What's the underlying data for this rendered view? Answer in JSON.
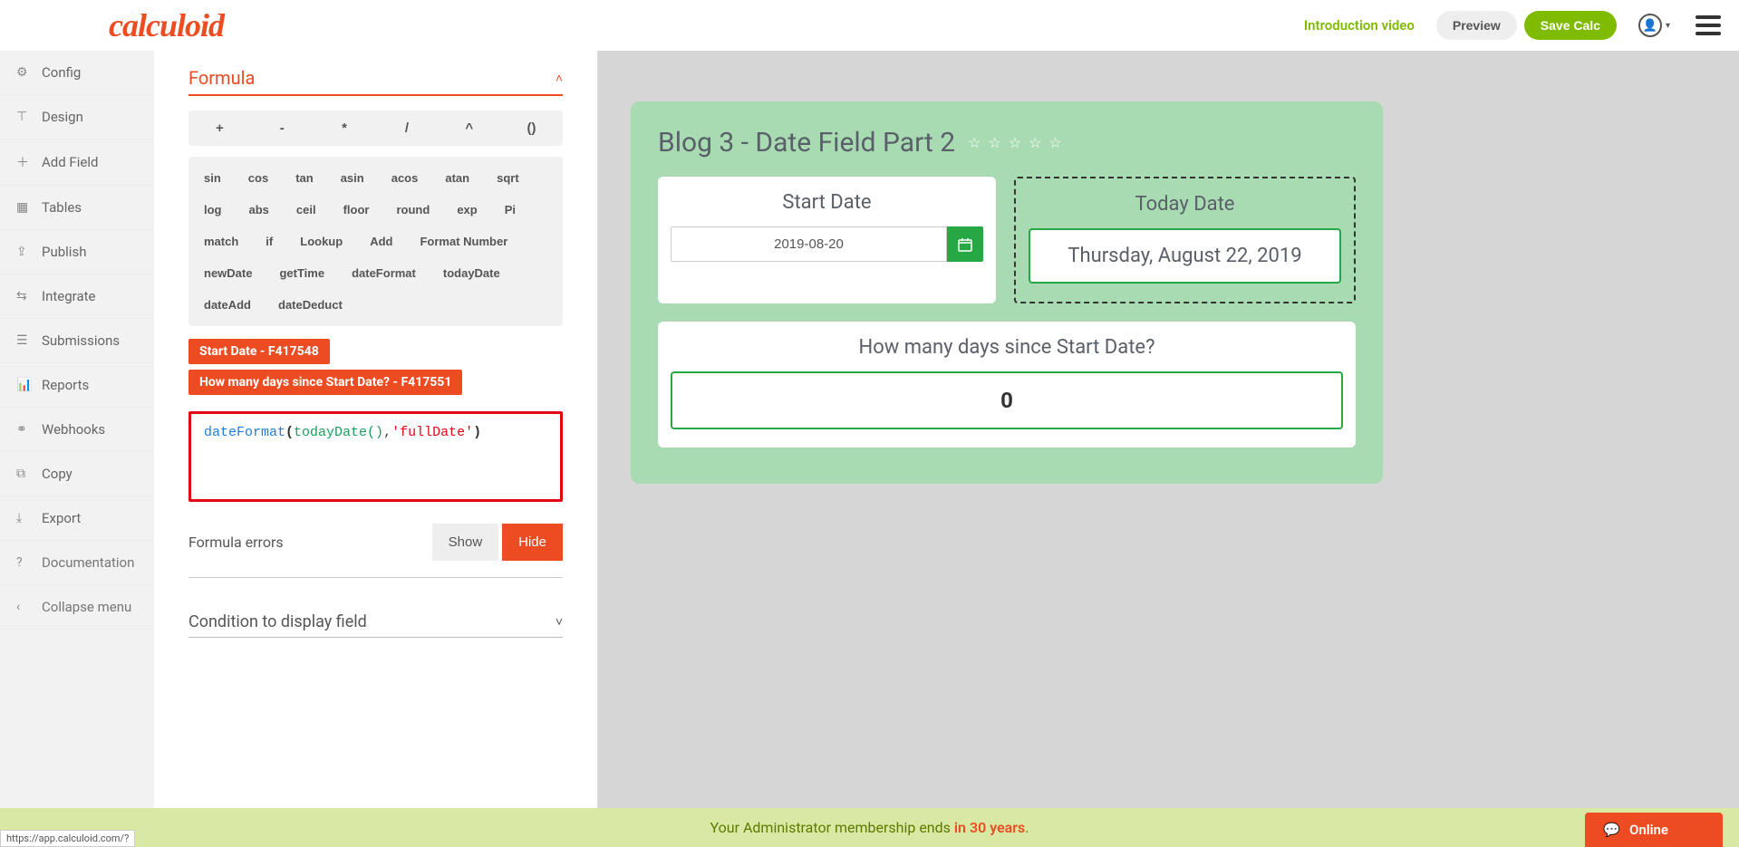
{
  "header": {
    "logo": "calculoid",
    "intro_link": "Introduction video",
    "preview": "Preview",
    "save": "Save Calc"
  },
  "sidebar": {
    "items": [
      {
        "icon": "⚙",
        "label": "Config"
      },
      {
        "icon": "⊤",
        "label": "Design"
      },
      {
        "icon": "＋",
        "label": "Add Field"
      },
      {
        "icon": "▦",
        "label": "Tables"
      },
      {
        "icon": "⇪",
        "label": "Publish"
      },
      {
        "icon": "⇆",
        "label": "Integrate"
      },
      {
        "icon": "☰",
        "label": "Submissions"
      },
      {
        "icon": "📊",
        "label": "Reports"
      },
      {
        "icon": "⚭",
        "label": "Webhooks"
      },
      {
        "icon": "⧉",
        "label": "Copy"
      },
      {
        "icon": "⤓",
        "label": "Export"
      },
      {
        "icon": "?",
        "label": "Documentation"
      },
      {
        "icon": "‹",
        "label": "Collapse menu"
      }
    ]
  },
  "panel": {
    "formula_title": "Formula",
    "operators": [
      "+",
      "-",
      "*",
      "/",
      "^",
      "()"
    ],
    "functions": [
      "sin",
      "cos",
      "tan",
      "asin",
      "acos",
      "atan",
      "sqrt",
      "log",
      "abs",
      "ceil",
      "floor",
      "round",
      "exp",
      "Pi",
      "match",
      "if",
      "Lookup",
      "Add",
      "Format Number",
      "newDate",
      "getTime",
      "dateFormat",
      "todayDate",
      "dateAdd",
      "dateDeduct"
    ],
    "field_tags": [
      "Start Date - F417548",
      "How many days since Start Date? - F417551"
    ],
    "formula_tokens": {
      "fn": "dateFormat",
      "paren1": "(",
      "call": "todayDate()",
      "comma": ",",
      "str": "'fullDate'",
      "paren2": ")"
    },
    "errors_label": "Formula errors",
    "show": "Show",
    "hide": "Hide",
    "condition_title": "Condition to display field"
  },
  "canvas": {
    "title": "Blog 3 - Date Field Part 2",
    "start_label": "Start Date",
    "start_value": "2019-08-20",
    "today_label": "Today Date",
    "today_value": "Thursday, August 22, 2019",
    "days_label": "How many days since Start Date?",
    "days_value": "0"
  },
  "footer": {
    "prefix": "Your Administrator membership ends ",
    "highlight": "in 30 years",
    "suffix": "."
  },
  "status_url": "https://app.calculoid.com/?",
  "chat": "Online"
}
